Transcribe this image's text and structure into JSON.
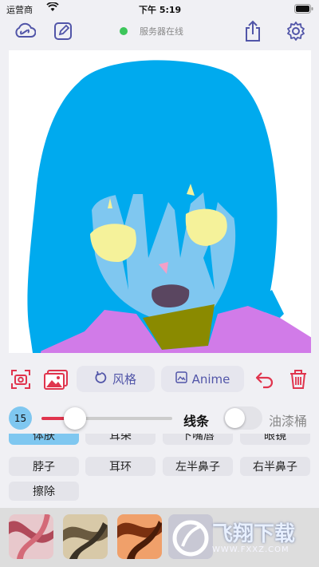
{
  "status_bar": {
    "carrier": "运营商",
    "time": "下午 5:19"
  },
  "server_status": {
    "label": "服务器在线",
    "color": "#3cc55a"
  },
  "toolbar_icons": [
    "cloud-link-icon",
    "edit-icon",
    "share-icon",
    "gear-icon"
  ],
  "actions": {
    "style_label": "风格",
    "anime_label": "Anime"
  },
  "brush": {
    "size": "15",
    "size_fraction": 0.17,
    "lines_label": "线条",
    "bucket_label": "油漆桶",
    "bucket_on": false
  },
  "labels": {
    "row0": [
      "体肤",
      "耳朵",
      "下嘴唇",
      "眼镜"
    ],
    "row1": [
      "脖子",
      "耳环",
      "左半鼻子",
      "右半鼻子"
    ],
    "row2": [
      "擦除"
    ],
    "selected": "体肤"
  },
  "watermark": {
    "text": "飞翔下载",
    "url": "WWW.FXXZ.COM"
  },
  "colors": {
    "accent": "#5155a8",
    "red": "#e0344d",
    "hair": "#00aaee",
    "skin": "#7fc7f0",
    "eyes": "#f5f29a",
    "cloth": "#d17be8"
  }
}
